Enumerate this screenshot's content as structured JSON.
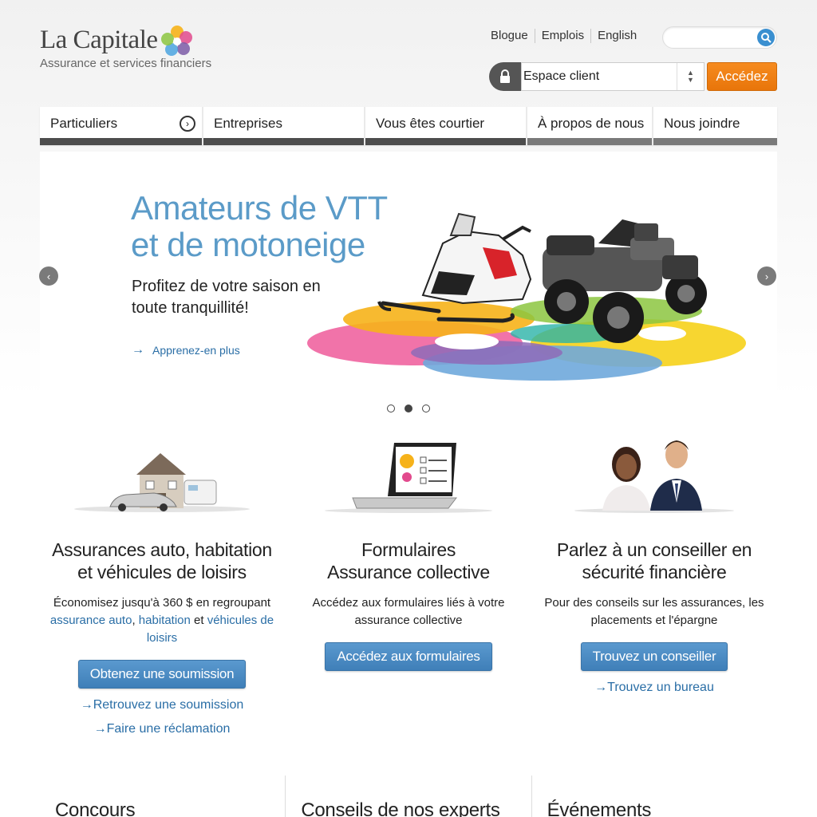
{
  "brand": {
    "name": "La Capitale",
    "tagline": "Assurance et services financiers"
  },
  "top_links": [
    "Blogue",
    "Emplois",
    "English"
  ],
  "search": {
    "placeholder": ""
  },
  "client": {
    "select_value": "Espace client",
    "go_label": "Accédez"
  },
  "nav": [
    {
      "label": "Particuliers"
    },
    {
      "label": "Entreprises"
    },
    {
      "label": "Vous êtes courtier"
    },
    {
      "label": "À propos de nous"
    },
    {
      "label": "Nous joindre"
    }
  ],
  "hero": {
    "title_line1": "Amateurs de VTT",
    "title_line2": "et de motoneige",
    "sub_line1": "Profitez de votre saison en",
    "sub_line2": "toute tranquillité!",
    "link": "Apprenez-en plus",
    "slides": 3,
    "active_slide": 2
  },
  "columns": [
    {
      "title_line1": "Assurances auto, habitation",
      "title_line2": "et véhicules de loisirs",
      "text_lead": "Économisez jusqu'à 360 $ en regroupant",
      "link_auto": "assurance auto",
      "link_hab": "habitation",
      "text_and": "et",
      "link_veh": "véhicules de loisirs",
      "button": "Obtenez une soumission",
      "links": [
        "Retrouvez une soumission",
        "Faire une réclamation"
      ]
    },
    {
      "title_line1": "Formulaires",
      "title_line2": "Assurance collective",
      "text_line1": "Accédez aux formulaires liés à votre",
      "text_line2": "assurance collective",
      "button": "Accédez aux formulaires"
    },
    {
      "title_line1": "Parlez à un conseiller en",
      "title_line2": "sécurité financière",
      "text_line1": "Pour des conseils sur les assurances, les",
      "text_line2": "placements et l'épargne",
      "button": "Trouvez un conseiller",
      "links": [
        "Trouvez un bureau"
      ]
    }
  ],
  "bottom": [
    "Concours",
    "Conseils de nos experts",
    "Événements"
  ],
  "colors": {
    "accent_blue": "#5b9bc8",
    "orange": "#f68b1f",
    "dark_nav": "#4d4d4d"
  }
}
